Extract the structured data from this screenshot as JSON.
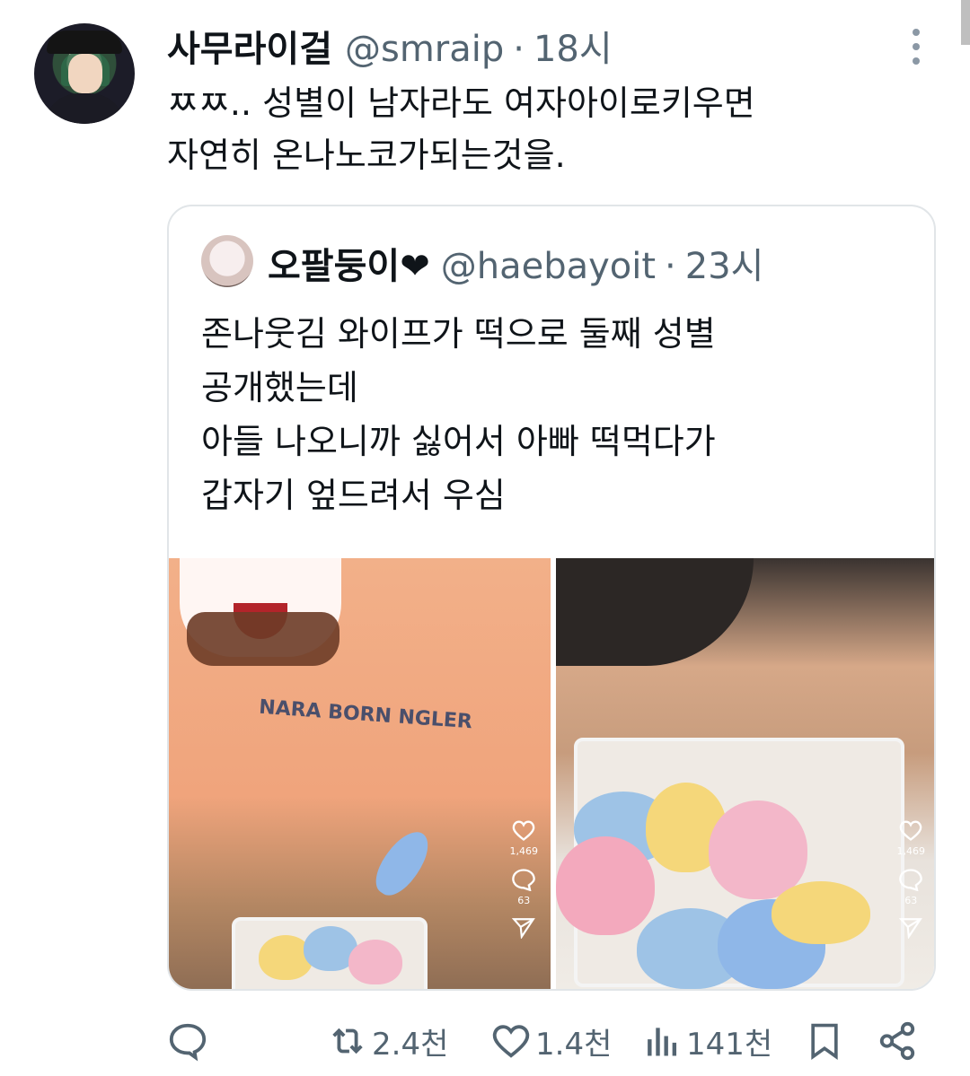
{
  "tweet": {
    "author_name": "사무라이걸",
    "author_handle": "@smraip",
    "separator": "·",
    "time": "18시",
    "text_lines": [
      "ㅉㅉ.. 성별이 남자라도 여자아이로키우면",
      "자연히 온나노코가되는것을."
    ]
  },
  "quote": {
    "author_name": "오팔둥이❤",
    "author_handle": "@haebayoit",
    "separator": "·",
    "time": "23시",
    "text_lines": [
      "존나웃김 와이프가 떡으로 둘째 성별",
      "공개했는데",
      "아들 나오니까 싫어서 아빠 떡먹다가",
      "갑자기 엎드려서 우심"
    ],
    "media": [
      {
        "shirt_text": "NARA BORN NGLER",
        "like_count": "1,469",
        "comment_count": "63"
      },
      {
        "like_count": "1,469",
        "comment_count": "63"
      }
    ]
  },
  "actions": {
    "reply_count": "",
    "retweet_count": "2.4천",
    "like_count": "1.4천",
    "views_count": "141천"
  },
  "icons": {
    "reply": "reply-icon",
    "retweet": "retweet-icon",
    "like": "heart-icon",
    "views": "views-icon",
    "bookmark": "bookmark-icon",
    "share": "share-icon",
    "more": "more-icon"
  },
  "colors": {
    "text": "#0f1419",
    "secondary": "#536471",
    "border": "#e1e5e8"
  }
}
